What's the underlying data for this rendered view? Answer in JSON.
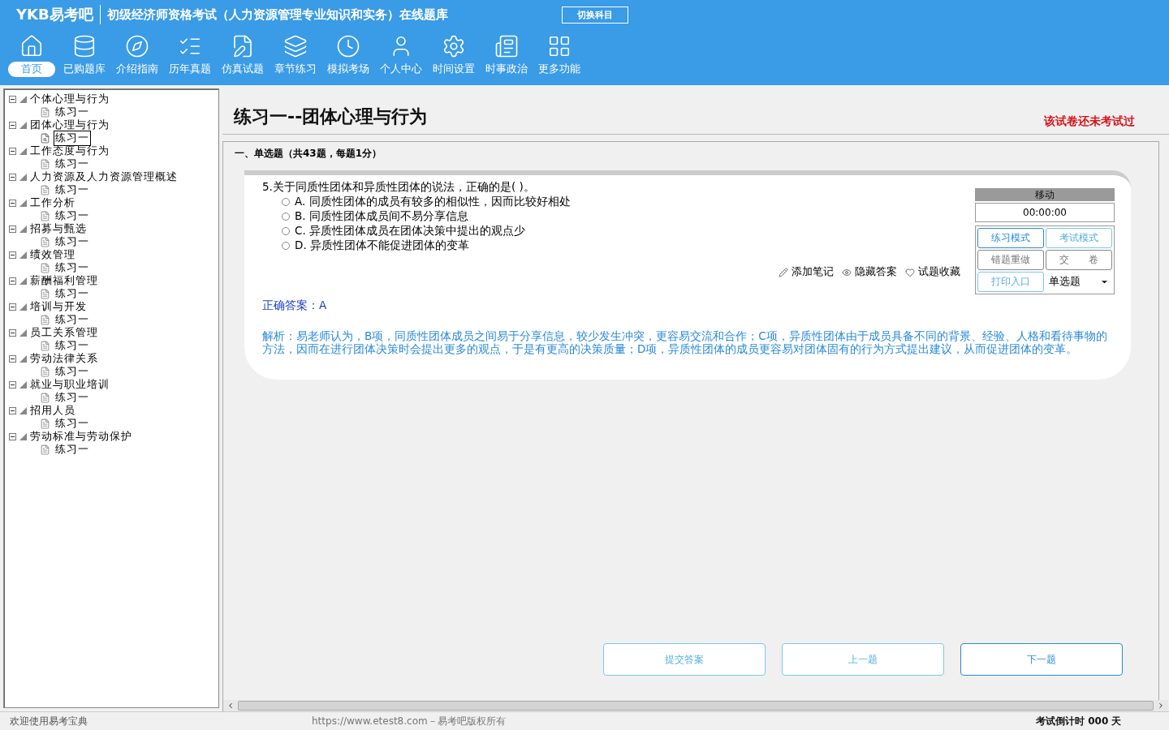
{
  "header": {
    "logo": "YKB易考吧",
    "title": "初级经济师资格考试（人力资源管理专业知识和实务）在线题库",
    "switch_button": "切换科目"
  },
  "nav": [
    {
      "label": "首页",
      "selected": true
    },
    {
      "label": "已购题库",
      "selected": false
    },
    {
      "label": "介绍指南",
      "selected": false
    },
    {
      "label": "历年真题",
      "selected": false
    },
    {
      "label": "仿真试题",
      "selected": false
    },
    {
      "label": "章节练习",
      "selected": false
    },
    {
      "label": "模拟考场",
      "selected": false
    },
    {
      "label": "个人中心",
      "selected": false
    },
    {
      "label": "时间设置",
      "selected": false
    },
    {
      "label": "时事政治",
      "selected": false
    },
    {
      "label": "更多功能",
      "selected": false
    }
  ],
  "tree": [
    {
      "label": "个体心理与行为",
      "expanded": true,
      "children": [
        {
          "label": "练习一",
          "selected": false
        }
      ]
    },
    {
      "label": "团体心理与行为",
      "expanded": true,
      "children": [
        {
          "label": "练习一",
          "selected": true
        }
      ]
    },
    {
      "label": "工作态度与行为",
      "expanded": true,
      "children": [
        {
          "label": "练习一",
          "selected": false
        }
      ]
    },
    {
      "label": "人力资源及人力资源管理概述",
      "expanded": true,
      "children": [
        {
          "label": "练习一",
          "selected": false
        }
      ]
    },
    {
      "label": "工作分析",
      "expanded": true,
      "children": [
        {
          "label": "练习一",
          "selected": false
        }
      ]
    },
    {
      "label": "招募与甄选",
      "expanded": true,
      "children": [
        {
          "label": "练习一",
          "selected": false
        }
      ]
    },
    {
      "label": "绩效管理",
      "expanded": true,
      "children": [
        {
          "label": "练习一",
          "selected": false
        }
      ]
    },
    {
      "label": "薪酬福利管理",
      "expanded": true,
      "children": [
        {
          "label": "练习一",
          "selected": false
        }
      ]
    },
    {
      "label": "培训与开发",
      "expanded": true,
      "children": [
        {
          "label": "练习一",
          "selected": false
        }
      ]
    },
    {
      "label": "员工关系管理",
      "expanded": true,
      "children": [
        {
          "label": "练习一",
          "selected": false
        }
      ]
    },
    {
      "label": "劳动法律关系",
      "expanded": true,
      "children": [
        {
          "label": "练习一",
          "selected": false
        }
      ]
    },
    {
      "label": "就业与职业培训",
      "expanded": true,
      "children": [
        {
          "label": "练习一",
          "selected": false
        }
      ]
    },
    {
      "label": "招用人员",
      "expanded": true,
      "children": [
        {
          "label": "练习一",
          "selected": false
        }
      ]
    },
    {
      "label": "劳动标准与劳动保护",
      "expanded": true,
      "children": [
        {
          "label": "练习一",
          "selected": false
        }
      ]
    }
  ],
  "exam": {
    "title": "练习一--团体心理与行为",
    "status": "该试卷还未考试过",
    "section": "一、单选题（共43题，每题1分）"
  },
  "question": {
    "stem": "5.关于同质性团体和异质性团体的说法，正确的是( )。",
    "options": [
      {
        "label": "A. 同质性团体的成员有较多的相似性，因而比较好相处",
        "selected": false
      },
      {
        "label": "B. 同质性团体成员间不易分享信息",
        "selected": false
      },
      {
        "label": "C. 异质性团体成员在团体决策中提出的观点少",
        "selected": false
      },
      {
        "label": "D. 异质性团体不能促进团体的变革",
        "selected": false
      }
    ],
    "tools": [
      {
        "label": "添加笔记"
      },
      {
        "label": "隐藏答案"
      },
      {
        "label": "试题收藏"
      }
    ],
    "answer": "正确答案：A",
    "analysis": "解析：易老师认为，B项，同质性团体成员之间易于分享信息，较少发生冲突，更容易交流和合作；C项，异质性团体由于成员具备不同的背景、经验、人格和看待事物的方法，因而在进行团体决策时会提出更多的观点，于是有更高的决策质量；D项，异质性团体的成员更容易对团体固有的行为方式提出建议，从而促进团体的变革。"
  },
  "control_panel": {
    "header": "移动",
    "timer": "00:00:00",
    "buttons": [
      {
        "label": "练习模式",
        "kind": "active"
      },
      {
        "label": "考试模式",
        "kind": "light"
      },
      {
        "label": "错题重做",
        "kind": "grey"
      },
      {
        "label": "交　　卷",
        "kind": "grey"
      },
      {
        "label": "打印入口",
        "kind": "light"
      }
    ],
    "question_type": "单选题"
  },
  "footer_buttons": [
    {
      "label": "提交答案",
      "kind": "light"
    },
    {
      "label": "上一题",
      "kind": "light"
    },
    {
      "label": "下一题",
      "kind": "active"
    }
  ],
  "status_bar": {
    "welcome": "欢迎使用易考宝典",
    "copyright": "https://www.etest8.com－易考吧版权所有",
    "countdown": "考试倒计时 000 天"
  }
}
